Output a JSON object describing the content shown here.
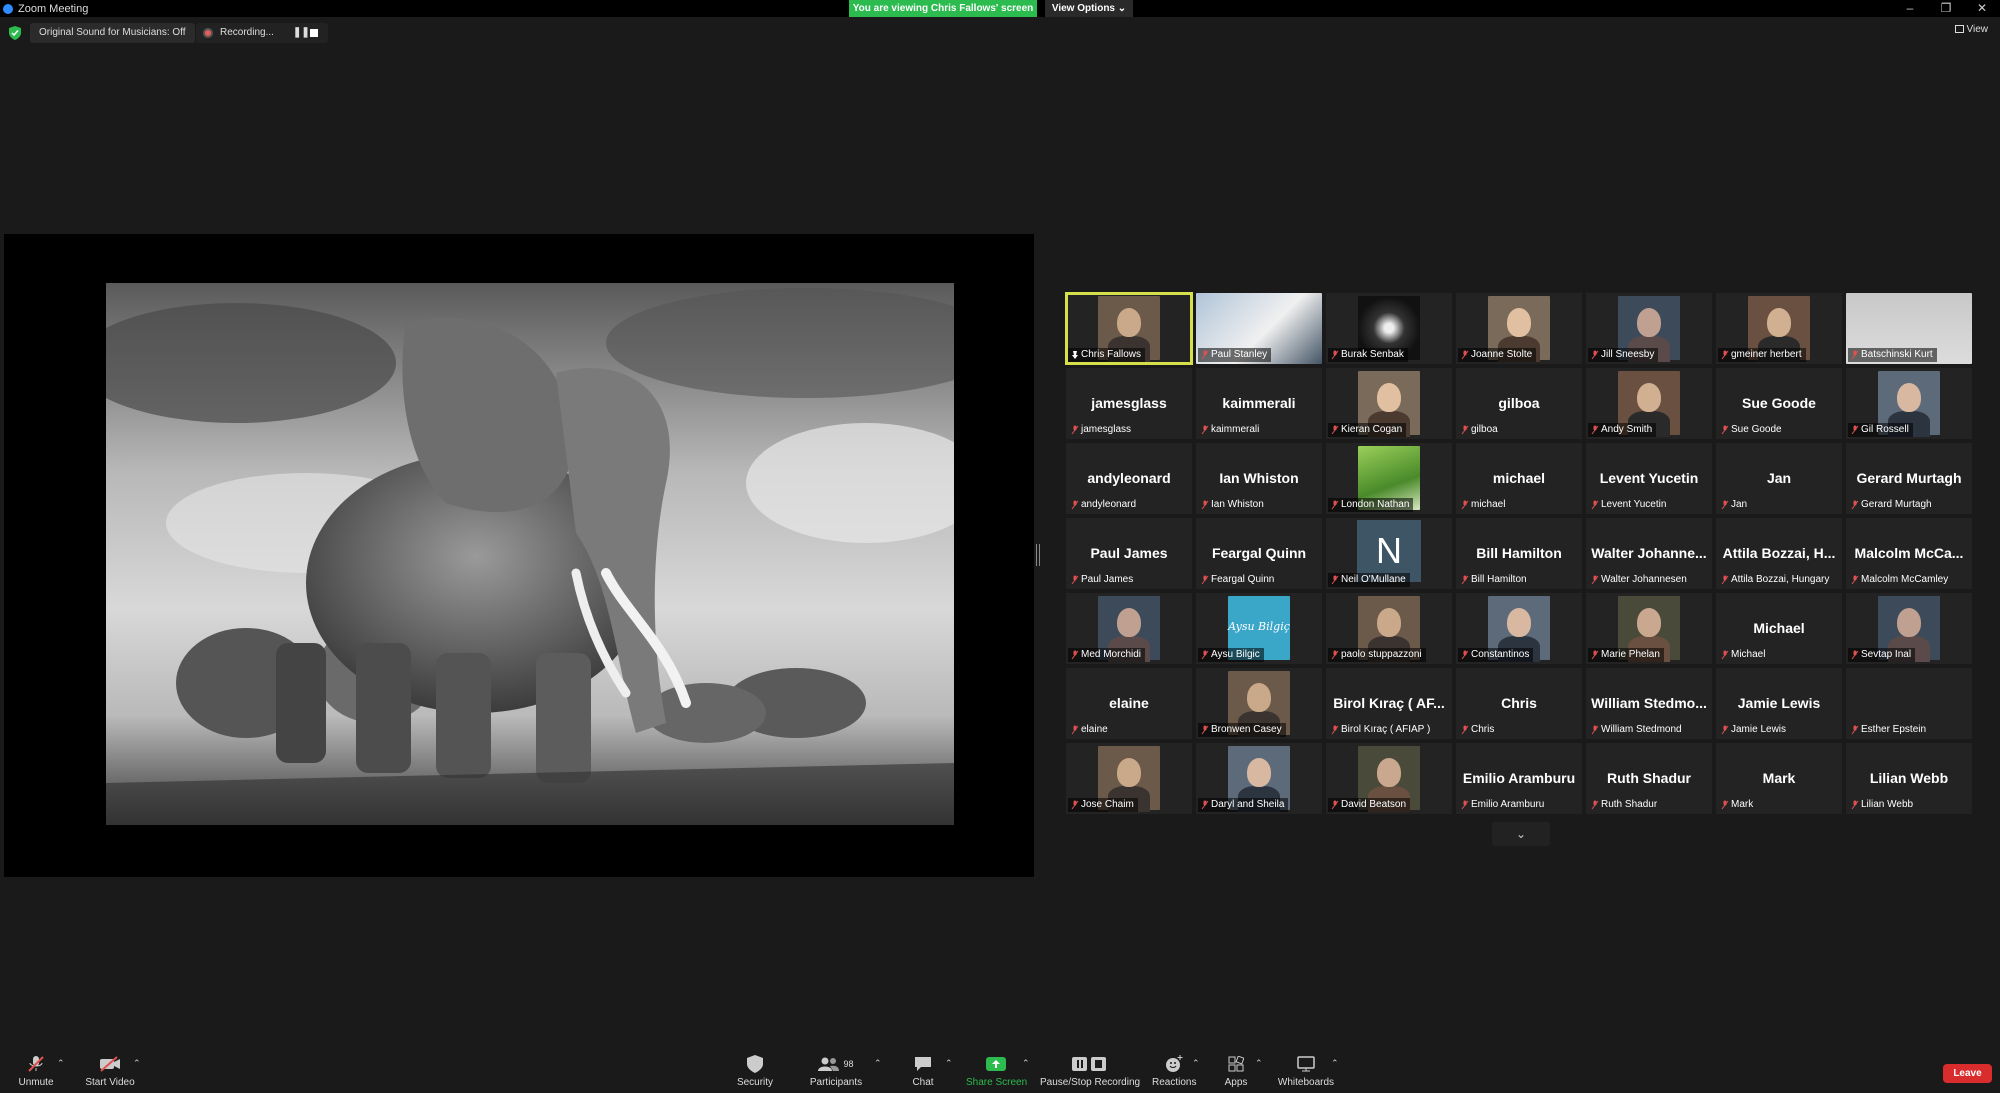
{
  "window": {
    "title": "Zoom Meeting",
    "minimize": "–",
    "restore": "❐",
    "close": "✕"
  },
  "banner": {
    "viewing": "You are viewing Chris Fallows' screen",
    "view_options": "View Options ⌄"
  },
  "status": {
    "original_sound": "Original Sound for Musicians: Off",
    "recording": "Recording...",
    "pause_glyph": "❚❚",
    "view_label": "View"
  },
  "colors": {
    "accent_green": "#2bbb4f",
    "active_speaker": "#d6e04a",
    "leave_red": "#d92d2d",
    "mic_off_red": "#e05050"
  },
  "gallery": {
    "more_glyph": "⌄",
    "tiles": [
      {
        "big": "",
        "label": "Chris Fallows",
        "video": "person",
        "active": true,
        "pinned": true
      },
      {
        "big": "",
        "label": "Paul Stanley",
        "video": "poster"
      },
      {
        "big": "",
        "label": "Burak Senbak",
        "video": "abstract"
      },
      {
        "big": "",
        "label": "Joanne Stolte",
        "video": "person"
      },
      {
        "big": "",
        "label": "Jill Sneesby",
        "video": "person"
      },
      {
        "big": "",
        "label": "gmeiner herbert",
        "video": "person"
      },
      {
        "big": "",
        "label": "Batschinski Kurt",
        "video": "wall"
      },
      {
        "big": "jamesglass",
        "label": "jamesglass",
        "video": ""
      },
      {
        "big": "kaimmerali",
        "label": "kaimmerali",
        "video": ""
      },
      {
        "big": "",
        "label": "Kieran Cogan",
        "video": "person"
      },
      {
        "big": "gilboa",
        "label": "gilboa",
        "video": ""
      },
      {
        "big": "",
        "label": "Andy Smith",
        "video": "person"
      },
      {
        "big": "Sue Goode",
        "label": "Sue Goode",
        "video": ""
      },
      {
        "big": "",
        "label": "Gil Rossell",
        "video": "person"
      },
      {
        "big": "andyleonard",
        "label": "andyleonard",
        "video": ""
      },
      {
        "big": "Ian Whiston",
        "label": "Ian Whiston",
        "video": ""
      },
      {
        "big": "",
        "label": "London Nathan",
        "video": "grass"
      },
      {
        "big": "michael",
        "label": "michael",
        "video": ""
      },
      {
        "big": "Levent Yucetin",
        "label": "Levent Yucetin",
        "video": ""
      },
      {
        "big": "Jan",
        "label": "Jan",
        "video": ""
      },
      {
        "big": "Gerard Murtagh",
        "label": "Gerard Murtagh",
        "video": ""
      },
      {
        "big": "Paul James",
        "label": "Paul James",
        "video": ""
      },
      {
        "big": "Feargal Quinn",
        "label": "Feargal Quinn",
        "video": ""
      },
      {
        "big": "",
        "label": "Neil O'Mullane",
        "video": "initial",
        "initial": "N"
      },
      {
        "big": "Bill Hamilton",
        "label": "Bill Hamilton",
        "video": ""
      },
      {
        "big": "Walter  Johanne...",
        "label": "Walter Johannesen",
        "video": ""
      },
      {
        "big": "Attila Bozzai, H...",
        "label": "Attila Bozzai, Hungary",
        "video": ""
      },
      {
        "big": "Malcolm McCa...",
        "label": "Malcolm McCamley",
        "video": ""
      },
      {
        "big": "",
        "label": "Med Morchidi",
        "video": "person"
      },
      {
        "big": "",
        "label": "Aysu Bilgic",
        "video": "logo",
        "logo_text": "Aysu Bilgiç"
      },
      {
        "big": "",
        "label": "paolo stuppazzoni",
        "video": "person"
      },
      {
        "big": "",
        "label": "Constantinos",
        "video": "person"
      },
      {
        "big": "",
        "label": "Marie Phelan",
        "video": "person"
      },
      {
        "big": "Michael",
        "label": "Michael",
        "video": ""
      },
      {
        "big": "",
        "label": "Sevtap Inal",
        "video": "person"
      },
      {
        "big": "elaine",
        "label": "elaine",
        "video": ""
      },
      {
        "big": "",
        "label": "Bronwen Casey",
        "video": "person"
      },
      {
        "big": "Birol Kıraç  ( AF...",
        "label": "Birol Kıraç  ( AFIAP )",
        "video": ""
      },
      {
        "big": "Chris",
        "label": "Chris",
        "video": ""
      },
      {
        "big": "William  Stedmo...",
        "label": "William Stedmond",
        "video": ""
      },
      {
        "big": "Jamie Lewis",
        "label": "Jamie Lewis",
        "video": ""
      },
      {
        "big": "",
        "label": "Esther Epstein",
        "video": ""
      },
      {
        "big": "",
        "label": "Jose Chaim",
        "video": "person"
      },
      {
        "big": "",
        "label": "Daryl and Sheila",
        "video": "person"
      },
      {
        "big": "",
        "label": "David Beatson",
        "video": "person"
      },
      {
        "big": "Emilio Aramburu",
        "label": "Emilio Aramburu",
        "video": ""
      },
      {
        "big": "Ruth Shadur",
        "label": "Ruth Shadur",
        "video": ""
      },
      {
        "big": "Mark",
        "label": "Mark",
        "video": ""
      },
      {
        "big": "Lilian Webb",
        "label": "Lilian Webb",
        "video": ""
      }
    ]
  },
  "toolbar": {
    "unmute": "Unmute",
    "start_video": "Start Video",
    "security": "Security",
    "participants": "Participants",
    "participants_count": "98",
    "chat": "Chat",
    "share_screen": "Share Screen",
    "pause_stop_recording": "Pause/Stop Recording",
    "reactions": "Reactions",
    "apps": "Apps",
    "whiteboards": "Whiteboards",
    "leave": "Leave",
    "caret": "⌃"
  }
}
